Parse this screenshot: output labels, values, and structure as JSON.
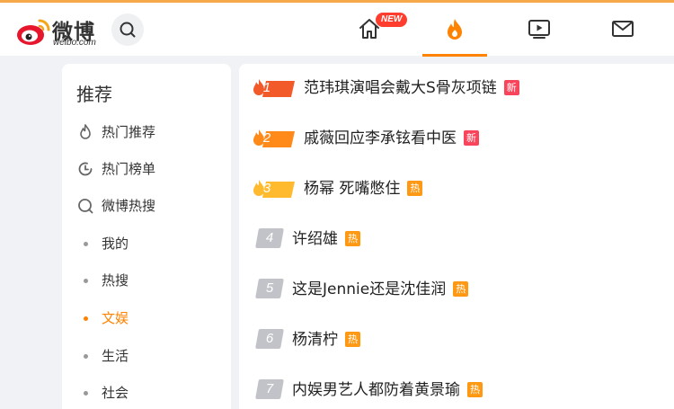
{
  "header": {
    "logo_text": "微博",
    "logo_url": "weibo.com",
    "new_badge": "NEW",
    "colors": {
      "accent": "#ff8200",
      "border": "#f7a84a",
      "new_badge": "#ff3d2e"
    },
    "nav_icons": [
      "home-icon",
      "hot-flame-icon",
      "video-icon",
      "mail-icon"
    ]
  },
  "sidebar": {
    "title": "推荐",
    "items": [
      {
        "label": "热门推荐",
        "icon": "flame-outline-icon"
      },
      {
        "label": "热门榜单",
        "icon": "clock-ranking-icon"
      },
      {
        "label": "微博热搜",
        "icon": "search-hot-icon"
      },
      {
        "label": "我的"
      },
      {
        "label": "热搜"
      },
      {
        "label": "文娱",
        "active": true
      },
      {
        "label": "生活"
      },
      {
        "label": "社会"
      }
    ]
  },
  "hot_list": [
    {
      "rank": "1",
      "title": "范玮琪演唱会戴大S骨灰项链",
      "tag": "新",
      "tag_color": "#f8455c"
    },
    {
      "rank": "2",
      "title": "戚薇回应李承铉看中医",
      "tag": "新",
      "tag_color": "#f8455c"
    },
    {
      "rank": "3",
      "title": "杨幂 死嘴憋住",
      "tag": "热",
      "tag_color": "#ff9812"
    },
    {
      "rank": "4",
      "title": "许绍雄",
      "tag": "热",
      "tag_color": "#ff9812"
    },
    {
      "rank": "5",
      "title": "这是Jennie还是沈佳润",
      "tag": "热",
      "tag_color": "#ff9812"
    },
    {
      "rank": "6",
      "title": "杨清柠",
      "tag": "热",
      "tag_color": "#ff9812"
    },
    {
      "rank": "7",
      "title": "内娱男艺人都防着黄景瑜",
      "tag": "热",
      "tag_color": "#ff9812"
    }
  ]
}
